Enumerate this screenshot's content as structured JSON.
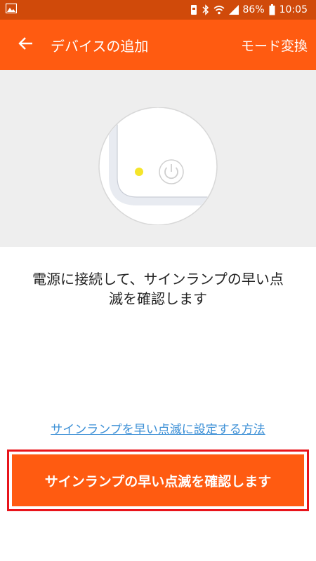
{
  "status_bar": {
    "battery_percent": "86%",
    "time": "10:05",
    "icons": [
      "image-icon",
      "vibrate-icon",
      "bluetooth-icon",
      "wifi-icon",
      "signal-icon",
      "battery-icon"
    ]
  },
  "app_bar": {
    "title": "デバイスの追加",
    "mode_label": "モード変換",
    "back_icon": "arrow-left-icon"
  },
  "illustration": {
    "indicator_color": "#f5e52a",
    "icon": "power-icon"
  },
  "instruction": {
    "text": "電源に接続して、サインランプの早い点滅を確認します"
  },
  "help_link": {
    "label": "サインランプを早い点滅に設定する方法"
  },
  "confirm_button": {
    "label": "サインランプの早い点滅を確認します"
  },
  "colors": {
    "status_bar": "#d04a0a",
    "accent": "#ff5b11",
    "highlight_border": "#e8141b",
    "link": "#3b8fd6"
  }
}
